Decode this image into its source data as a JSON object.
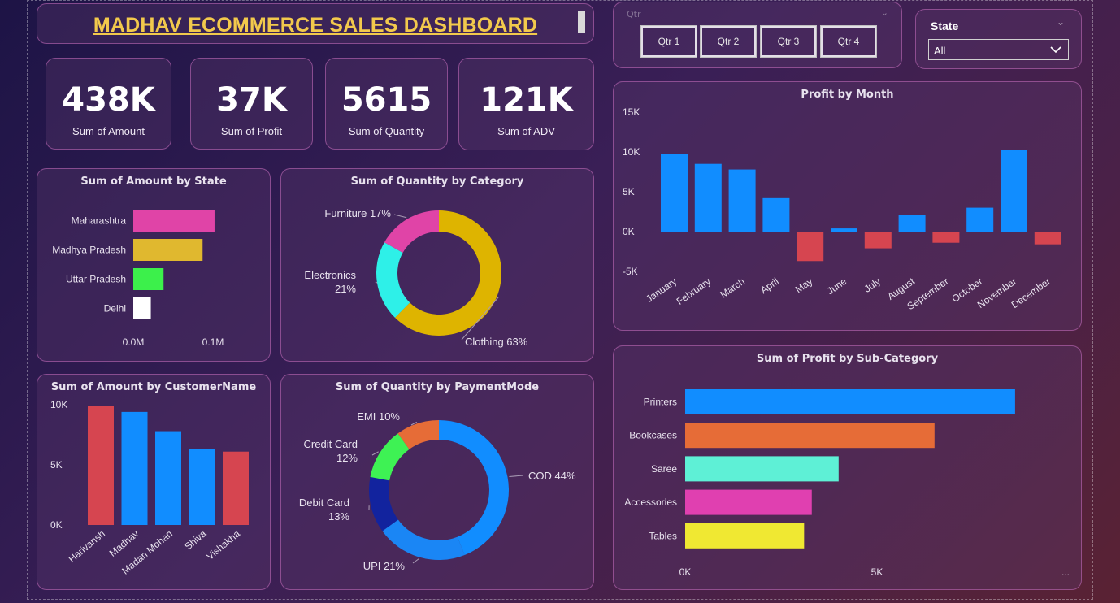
{
  "dashboard": {
    "title": "MADHAV ECOMMERCE SALES DASHBOARD"
  },
  "kpis": [
    {
      "value": "438K",
      "label": "Sum of Amount"
    },
    {
      "value": "37K",
      "label": "Sum of Profit"
    },
    {
      "value": "5615",
      "label": "Sum of Quantity"
    },
    {
      "value": "121K",
      "label": "Sum of ADV"
    }
  ],
  "slicers": {
    "quarter": {
      "label": "Qtr",
      "options": [
        "Qtr 1",
        "Qtr 2",
        "Qtr 3",
        "Qtr 4"
      ]
    },
    "state": {
      "title": "State",
      "value": "All"
    }
  },
  "colors": {
    "blue": "#118dff",
    "red": "#d64550",
    "pink": "#e044a7",
    "gold": "#e0b82f",
    "green": "#3cf04b",
    "white": "#ffffff",
    "teal": "#2ef0e8",
    "yellow": "#deb400",
    "orange": "#e66c37",
    "lime": "#3ef254",
    "navy": "#12239e",
    "skyblue": "#1a86f5",
    "aqua": "#5ef0d6",
    "magenta": "#e040b0",
    "lemon": "#f0e832"
  },
  "chart_data": [
    {
      "id": "amount_by_state",
      "type": "bar",
      "orientation": "horizontal",
      "title": "Sum of Amount by State",
      "categories": [
        "Maharashtra",
        "Madhya Pradesh",
        "Uttar Pradesh",
        "Delhi"
      ],
      "values": [
        0.102,
        0.087,
        0.038,
        0.022
      ],
      "colors": [
        "#e044a7",
        "#e0b82f",
        "#3cf04b",
        "#ffffff"
      ],
      "xlim": [
        0,
        0.1
      ],
      "xticks": [
        "0.0M",
        "0.1M"
      ],
      "grid": false
    },
    {
      "id": "quantity_by_category",
      "type": "pie",
      "donut": true,
      "title": "Sum of Quantity by Category",
      "categories": [
        "Clothing",
        "Electronics",
        "Furniture"
      ],
      "values": [
        63,
        21,
        17
      ],
      "labels": [
        "Clothing 63%",
        "Electronics 21%",
        "Furniture 17%"
      ],
      "colors": [
        "#deb400",
        "#2ef0e8",
        "#e044a7"
      ]
    },
    {
      "id": "profit_by_month",
      "type": "bar",
      "title": "Profit by Month",
      "categories": [
        "January",
        "February",
        "March",
        "April",
        "May",
        "June",
        "July",
        "August",
        "September",
        "October",
        "November",
        "December"
      ],
      "values": [
        9700,
        8500,
        7800,
        4200,
        -3700,
        400,
        -2100,
        2100,
        -1400,
        3000,
        10300,
        -1600
      ],
      "ylim": [
        -5000,
        15000
      ],
      "yticks": [
        {
          "v": 15000,
          "t": "15K"
        },
        {
          "v": 10000,
          "t": "10K"
        },
        {
          "v": 5000,
          "t": "5K"
        },
        {
          "v": 0,
          "t": "0K"
        },
        {
          "v": -5000,
          "t": "-5K"
        }
      ],
      "positive_color": "#118dff",
      "negative_color": "#d64550",
      "grid": false
    },
    {
      "id": "amount_by_customer",
      "type": "bar",
      "title": "Sum of Amount by CustomerName",
      "categories": [
        "Harivansh",
        "Madhav",
        "Madan Mohan",
        "Shiva",
        "Vishakha"
      ],
      "values": [
        9900,
        9400,
        7800,
        6300,
        6100
      ],
      "colors": [
        "#d64550",
        "#118dff",
        "#118dff",
        "#118dff",
        "#d64550"
      ],
      "ylim": [
        0,
        10000
      ],
      "yticks": [
        {
          "v": 10000,
          "t": "10K"
        },
        {
          "v": 5000,
          "t": "5K"
        },
        {
          "v": 0,
          "t": "0K"
        }
      ],
      "grid": false
    },
    {
      "id": "quantity_by_paymentmode",
      "type": "pie",
      "donut": true,
      "title": "Sum of Quantity by PaymentMode",
      "categories": [
        "COD",
        "UPI",
        "Debit Card",
        "Credit Card",
        "EMI"
      ],
      "values": [
        44,
        21,
        13,
        12,
        10
      ],
      "labels": [
        "COD 44%",
        "UPI 21%",
        "Debit Card 13%",
        "Credit Card 12%",
        "EMI 10%"
      ],
      "colors": [
        "#118dff",
        "#1a86f5",
        "#12239e",
        "#3ef254",
        "#e66c37"
      ]
    },
    {
      "id": "profit_by_subcategory",
      "type": "bar",
      "orientation": "horizontal",
      "title": "Sum of Profit by Sub-Category",
      "categories": [
        "Printers",
        "Bookcases",
        "Saree",
        "Accessories",
        "Tables"
      ],
      "values": [
        8600,
        6500,
        4000,
        3300,
        3100
      ],
      "colors": [
        "#118dff",
        "#e66c37",
        "#5ef0d6",
        "#e040b0",
        "#f0e832"
      ],
      "xlim": [
        0,
        10000
      ],
      "xticks": [
        {
          "v": 0,
          "t": "0K"
        },
        {
          "v": 5000,
          "t": "5K"
        }
      ],
      "more_indicator": "...",
      "grid": false
    }
  ]
}
